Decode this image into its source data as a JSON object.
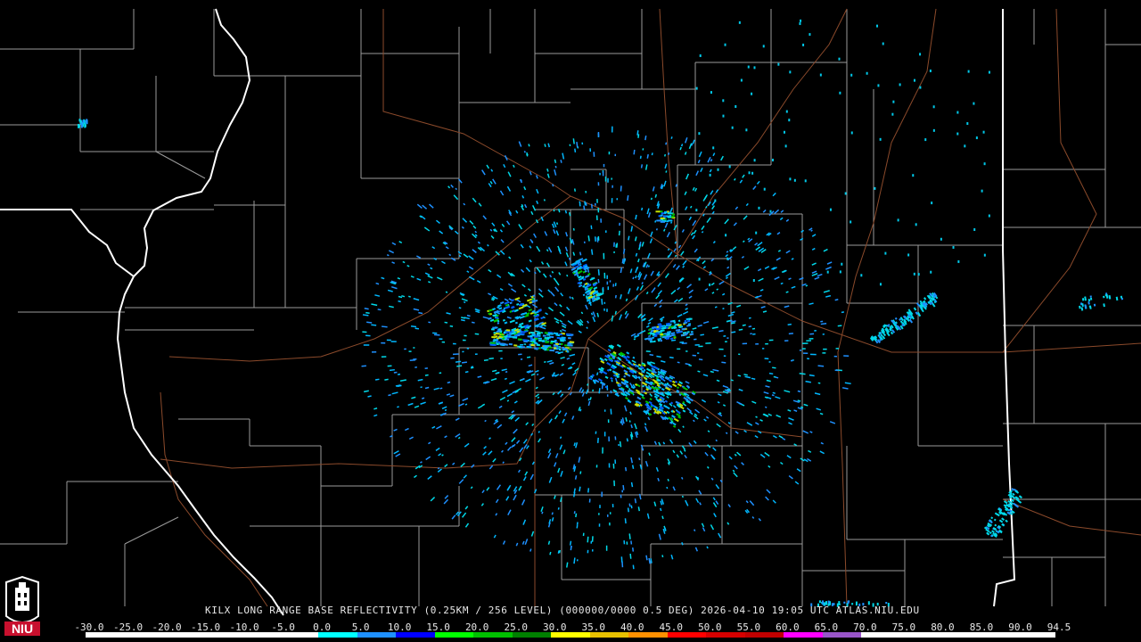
{
  "product": {
    "caption": "KILX LONG RANGE BASE REFLECTIVITY (0.25KM / 256 LEVEL) (000000/0000 0.5 DEG) 2026-04-10 19:05 UTC  ATLAS.NIU.EDU"
  },
  "scale": {
    "labels": [
      "-30.0",
      "-25.0",
      "-20.0",
      "-15.0",
      "-10.0",
      "-5.0",
      "0.0",
      "5.0",
      "10.0",
      "15.0",
      "20.0",
      "25.0",
      "30.0",
      "35.0",
      "40.0",
      "45.0",
      "50.0",
      "55.0",
      "60.0",
      "65.0",
      "70.0",
      "75.0",
      "80.0",
      "85.0",
      "90.0",
      "94.5"
    ],
    "colors": [
      "#ffffff",
      "#ffffff",
      "#ffffff",
      "#ffffff",
      "#ffffff",
      "#ffffff",
      "#00ffff",
      "#1e90ff",
      "#0000ff",
      "#00ff00",
      "#00c000",
      "#008000",
      "#ffff00",
      "#e7c000",
      "#ff9000",
      "#ff0000",
      "#d60000",
      "#c00000",
      "#ff00ff",
      "#9955c9",
      "#ffffff",
      "#ffffff",
      "#ffffff",
      "#ffffff",
      "#ffffff"
    ]
  },
  "logo": {
    "text": "NIU",
    "color": "#c8102e"
  },
  "map_colors": {
    "county": "#9a9a9a",
    "state": "#ffffff",
    "highway": "#8b4a2b"
  }
}
